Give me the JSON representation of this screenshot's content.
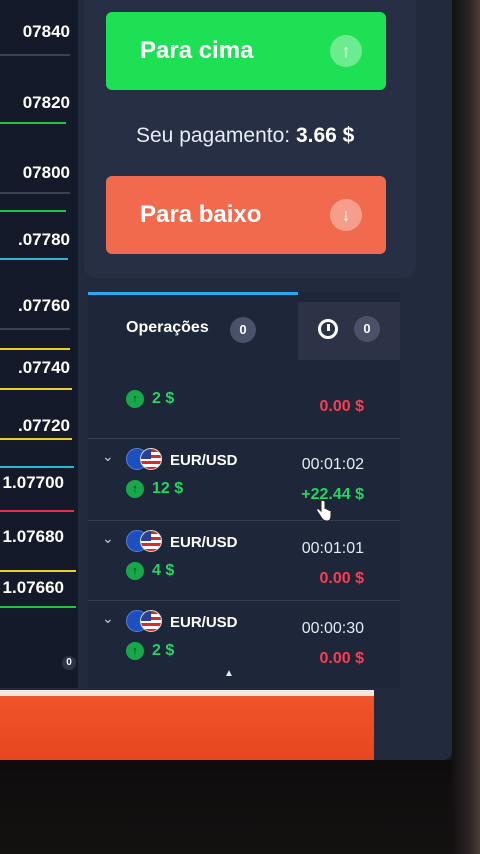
{
  "chart": {
    "prices": [
      "07840",
      "07820",
      "07800",
      ".07780",
      ".07760",
      ".07740",
      ".07720",
      "1.07700",
      "1.07680",
      "1.07660"
    ],
    "corner_badge": "0"
  },
  "trade": {
    "up_label": "Para cima",
    "down_label": "Para baixo",
    "payout_label": "Seu pagamento:",
    "payout_value": "3.66 $",
    "up_icon": "arrow-up-icon",
    "down_icon": "arrow-down-icon"
  },
  "operations": {
    "tab_label": "Operações",
    "tab_count": "0",
    "history_count": "0",
    "rows": [
      {
        "amount": "2 $",
        "result": "0.00 $"
      },
      {
        "pair": "EUR/USD",
        "time": "00:01:02",
        "amount": "12 $",
        "result": "+22.44 $"
      },
      {
        "pair": "EUR/USD",
        "time": "00:01:01",
        "amount": "4 $",
        "result": "0.00 $"
      },
      {
        "pair": "EUR/USD",
        "time": "00:00:30",
        "amount": "2 $",
        "result": "0.00 $"
      }
    ]
  },
  "colors": {
    "up": "#1ee054",
    "down": "#f26a4e",
    "gain": "#22d65f",
    "loss": "#ff3b4f",
    "accent": "#2aa8f0"
  }
}
